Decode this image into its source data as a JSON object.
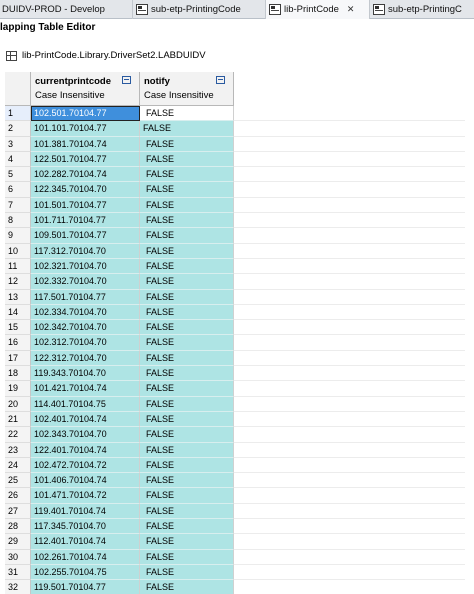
{
  "tabs": [
    {
      "label": "DUIDV-PROD - Develop",
      "icon": "none",
      "active": false,
      "closable": false
    },
    {
      "label": "sub-etp-PrintingCode",
      "icon": "mapping-table-icon",
      "active": false,
      "closable": false
    },
    {
      "label": "lib-PrintCode",
      "icon": "mapping-table-icon",
      "active": true,
      "closable": true,
      "close_glyph": "✕"
    },
    {
      "label": "sub-etp-PrintingC",
      "icon": "mapping-table-icon",
      "active": false,
      "closable": false
    }
  ],
  "editor_title": "lapping Table Editor",
  "breadcrumb": {
    "icon": "table-icon",
    "path": "lib-PrintCode.Library.DriverSet2.LABDUIDV"
  },
  "columns": [
    {
      "name": "currentprintcode",
      "subtitle": "Case Insensitive",
      "icon": "filter-icon"
    },
    {
      "name": "notify",
      "subtitle": "Case Insensitive",
      "icon": "filter-icon"
    }
  ],
  "selected_row": 1,
  "selected_color": "#3f8fdc",
  "cell_color": "#aee4e4",
  "rows": [
    {
      "n": "1",
      "code": "102.501.70104.77",
      "notify": "FALSE"
    },
    {
      "n": "2",
      "code": "101.101.70104.77",
      "notify": "FALSE"
    },
    {
      "n": "3",
      "code": "101.381.70104.74",
      "notify": "FALSE"
    },
    {
      "n": "4",
      "code": "122.501.70104.77",
      "notify": "FALSE"
    },
    {
      "n": "5",
      "code": "102.282.70104.74",
      "notify": "FALSE"
    },
    {
      "n": "6",
      "code": "122.345.70104.70",
      "notify": "FALSE"
    },
    {
      "n": "7",
      "code": "101.501.70104.77",
      "notify": "FALSE"
    },
    {
      "n": "8",
      "code": "101.711.70104.77",
      "notify": "FALSE"
    },
    {
      "n": "9",
      "code": "109.501.70104.77",
      "notify": "FALSE"
    },
    {
      "n": "10",
      "code": "117.312.70104.70",
      "notify": "FALSE"
    },
    {
      "n": "11",
      "code": "102.321.70104.70",
      "notify": "FALSE"
    },
    {
      "n": "12",
      "code": "102.332.70104.70",
      "notify": "FALSE"
    },
    {
      "n": "13",
      "code": "117.501.70104.77",
      "notify": "FALSE"
    },
    {
      "n": "14",
      "code": "102.334.70104.70",
      "notify": "FALSE"
    },
    {
      "n": "15",
      "code": "102.342.70104.70",
      "notify": "FALSE"
    },
    {
      "n": "16",
      "code": "102.312.70104.70",
      "notify": "FALSE"
    },
    {
      "n": "17",
      "code": "122.312.70104.70",
      "notify": "FALSE"
    },
    {
      "n": "18",
      "code": "119.343.70104.70",
      "notify": "FALSE"
    },
    {
      "n": "19",
      "code": "101.421.70104.74",
      "notify": "FALSE"
    },
    {
      "n": "20",
      "code": "114.401.70104.75",
      "notify": "FALSE"
    },
    {
      "n": "21",
      "code": "102.401.70104.74",
      "notify": "FALSE"
    },
    {
      "n": "22",
      "code": "102.343.70104.70",
      "notify": "FALSE"
    },
    {
      "n": "23",
      "code": "122.401.70104.74",
      "notify": "FALSE"
    },
    {
      "n": "24",
      "code": "102.472.70104.72",
      "notify": "FALSE"
    },
    {
      "n": "25",
      "code": "101.406.70104.74",
      "notify": "FALSE"
    },
    {
      "n": "26",
      "code": "101.471.70104.72",
      "notify": "FALSE"
    },
    {
      "n": "27",
      "code": "119.401.70104.74",
      "notify": "FALSE"
    },
    {
      "n": "28",
      "code": "117.345.70104.70",
      "notify": "FALSE"
    },
    {
      "n": "29",
      "code": "112.401.70104.74",
      "notify": "FALSE"
    },
    {
      "n": "30",
      "code": "102.261.70104.74",
      "notify": "FALSE"
    },
    {
      "n": "31",
      "code": "102.255.70104.75",
      "notify": "FALSE"
    },
    {
      "n": "32",
      "code": "119.501.70104.77",
      "notify": "FALSE"
    }
  ]
}
